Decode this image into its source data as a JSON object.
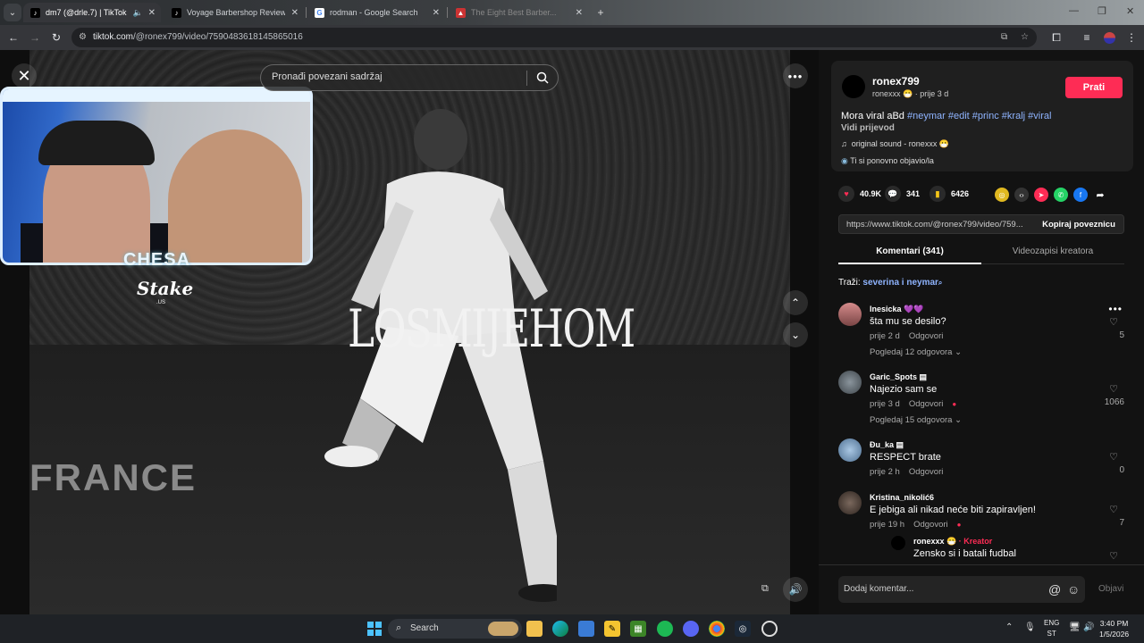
{
  "browser": {
    "tabs": [
      {
        "title": "dm7 (@drle.7) | TikTok",
        "active": true,
        "audio": true
      },
      {
        "title": "Voyage Barbershop Review",
        "active": false
      },
      {
        "title": "rodman - Google Search",
        "active": false
      },
      {
        "title": "The Eight Best Barber...",
        "active": false
      }
    ],
    "url_host": "tiktok.com",
    "url_path": "/@ronex799/video/7590483618145865016"
  },
  "video": {
    "search_placeholder": "Pronađi povezani sadržaj",
    "overlay_text": "LOSMIJEHOM",
    "board_text": "FRANCE",
    "streamer_name": "CHESA",
    "sponsor": "Stake",
    "sponsor_sub": ".US"
  },
  "post": {
    "author": "ronex799",
    "author_nick": "ronexxx",
    "posted": "· prije 3 d",
    "follow_label": "Prati",
    "caption_text": "Mora viral aBd ",
    "hashtags": [
      "#neymar",
      "#edit",
      "#princ",
      "#kralj",
      "#viral"
    ],
    "translate_label": "Vidi prijevod",
    "sound": "original sound - ronexxx",
    "repost_text": "Ti si ponovno objavio/la",
    "likes": "40.9K",
    "comments": "341",
    "saves": "6426",
    "link": "https://www.tiktok.com/@ronex799/video/759...",
    "copy_label": "Kopiraj poveznicu"
  },
  "panel_tabs": [
    "Komentari (341)",
    "Videozapisi kreatora"
  ],
  "search_hint": {
    "prefix": "Traži: ",
    "query": "severina i neymar"
  },
  "comments": [
    {
      "user": "Inesicka",
      "text": "šta mu se desilo?",
      "time": "prije 2 d",
      "reply": "Odgovori",
      "replies": "Pogledaj 12 odgovora",
      "likes": "5",
      "avatar": "#d58b8b"
    },
    {
      "user": "Garic_Spots",
      "text": "Najezio sam se",
      "time": "prije 3 d",
      "reply": "Odgovori",
      "replies": "Pogledaj 15 odgovora",
      "likes": "1066",
      "avatar": "#6b7680"
    },
    {
      "user": "Đu_ka",
      "text": "RESPECT brate",
      "time": "prije 2 h",
      "reply": "Odgovori",
      "replies": "",
      "likes": "0",
      "avatar": "#7da4c8"
    },
    {
      "user": "Kristina_nikolić6",
      "text": "E jebiga ali nikad neće biti zapiravljen!",
      "time": "prije 19 h",
      "reply": "Odgovori",
      "replies": "",
      "likes": "7",
      "avatar": "#5a4a42"
    }
  ],
  "reply": {
    "user": "ronexxx",
    "tag": "· Kreator",
    "text": "Zensko si i batali fudbal"
  },
  "comment_bar": {
    "placeholder": "Dodaj komentar...",
    "post_label": "Objavi"
  },
  "taskbar": {
    "search_label": "Search",
    "lang": "ENG",
    "lang_sub": "ST",
    "time": "3:40 PM",
    "date": "1/5/2026"
  },
  "colors": {
    "accent": "#fe2c55",
    "link": "#8fb4ff"
  }
}
